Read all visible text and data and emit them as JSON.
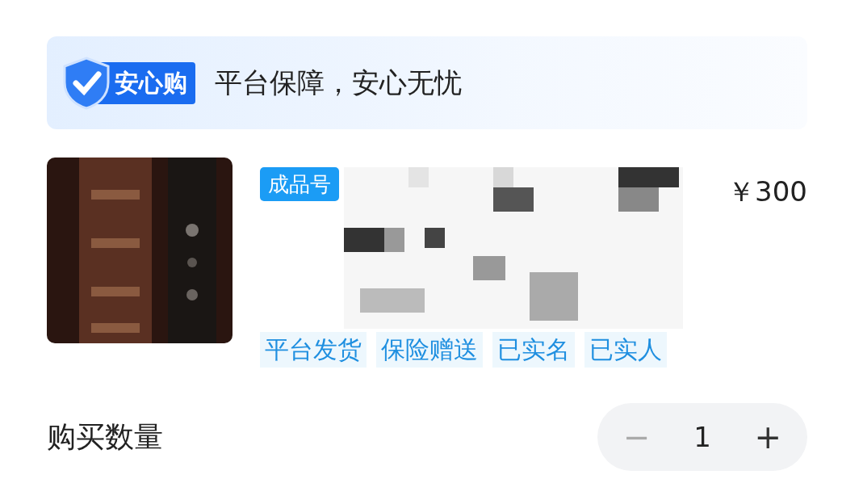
{
  "banner": {
    "badge": "安心购",
    "slogan": "平台保障，安心无忧"
  },
  "product": {
    "type_tag": "成品号",
    "price": "￥300",
    "tags": [
      "平台发货",
      "保险赠送",
      "已实名",
      "已实人"
    ]
  },
  "quantity": {
    "label": "购买数量",
    "minus": "−",
    "value": "1",
    "plus": "+",
    "minus_disabled": true
  }
}
